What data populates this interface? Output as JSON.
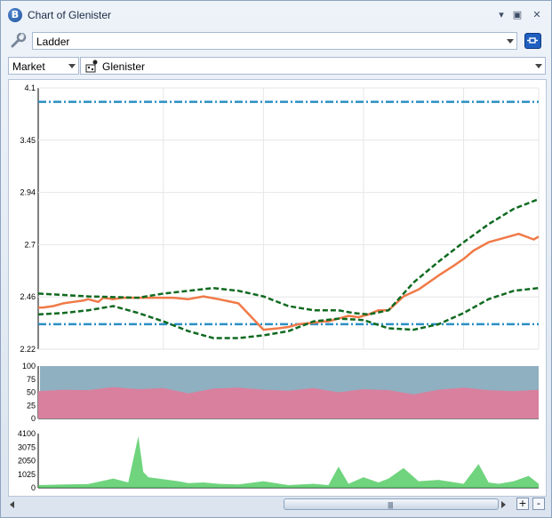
{
  "window": {
    "title": "Chart of Glenister",
    "app_icon_letter": "B",
    "pin_glyph": "▾",
    "maximize_glyph": "▣",
    "close_glyph": "✕"
  },
  "toolbar": {
    "view_select": "Ladder",
    "source_select": "Market",
    "runner_select": "Glenister"
  },
  "scrollbar": {
    "grip": "|||||",
    "zoom_in_label": "+",
    "zoom_out_label": "-"
  },
  "colors": {
    "price_line": "#f07a48",
    "band_line": "#0f6a20",
    "limit_line": "#2b8fc4",
    "back_fill": "#d9809f",
    "lay_fill": "#8fb0c0",
    "volume_fill": "#3fc552"
  },
  "chart_data": [
    {
      "type": "line",
      "name": "price",
      "yticks": [
        "4.1",
        "3.45",
        "2.94",
        "2.7",
        "2.46",
        "2.22"
      ],
      "ylim": [
        2.22,
        4.1
      ],
      "grid": true,
      "limit_lines": [
        4.0,
        2.4
      ],
      "series": [
        {
          "key": "price",
          "style": "solid",
          "x": [
            0,
            1,
            3,
            5,
            7,
            9,
            10,
            11,
            12,
            13,
            15,
            17,
            20,
            24,
            27,
            30,
            33,
            36,
            40,
            45,
            48,
            50,
            52,
            55,
            57,
            58,
            60,
            62,
            64,
            66,
            68,
            70,
            73,
            76,
            80,
            83,
            85,
            87,
            90,
            93,
            96,
            99,
            100
          ],
          "values": [
            2.52,
            2.52,
            2.53,
            2.55,
            2.56,
            2.57,
            2.58,
            2.57,
            2.56,
            2.59,
            2.58,
            2.59,
            2.59,
            2.59,
            2.59,
            2.58,
            2.6,
            2.58,
            2.55,
            2.36,
            2.37,
            2.38,
            2.4,
            2.41,
            2.42,
            2.42,
            2.44,
            2.46,
            2.45,
            2.47,
            2.5,
            2.5,
            2.6,
            2.65,
            2.75,
            2.82,
            2.87,
            2.93,
            2.99,
            3.02,
            3.05,
            3.01,
            3.03
          ]
        },
        {
          "key": "upper_band",
          "style": "dashed",
          "x": [
            0,
            10,
            20,
            25,
            30,
            35,
            40,
            45,
            50,
            55,
            60,
            63,
            66,
            70,
            75,
            80,
            85,
            90,
            95,
            100
          ],
          "values": [
            2.62,
            2.6,
            2.59,
            2.62,
            2.64,
            2.66,
            2.64,
            2.6,
            2.53,
            2.5,
            2.5,
            2.48,
            2.47,
            2.5,
            2.7,
            2.85,
            2.99,
            3.12,
            3.23,
            3.3
          ]
        },
        {
          "key": "lower_band",
          "style": "dashed",
          "x": [
            0,
            5,
            10,
            15,
            20,
            25,
            30,
            35,
            40,
            45,
            50,
            55,
            60,
            65,
            70,
            75,
            80,
            85,
            90,
            95,
            100
          ],
          "values": [
            2.47,
            2.48,
            2.5,
            2.53,
            2.48,
            2.42,
            2.35,
            2.3,
            2.3,
            2.32,
            2.35,
            2.42,
            2.44,
            2.43,
            2.37,
            2.36,
            2.4,
            2.48,
            2.58,
            2.64,
            2.66
          ]
        }
      ]
    },
    {
      "type": "area",
      "name": "weight-of-money",
      "yticks": [
        "100",
        "75",
        "50",
        "25",
        "0"
      ],
      "ylim": [
        0,
        100
      ],
      "series": [
        {
          "key": "back_share",
          "x": [
            0,
            5,
            10,
            15,
            20,
            25,
            30,
            35,
            40,
            45,
            50,
            55,
            60,
            65,
            70,
            75,
            80,
            85,
            90,
            95,
            100
          ],
          "values": [
            52,
            55,
            54,
            60,
            56,
            58,
            48,
            57,
            59,
            55,
            53,
            58,
            50,
            56,
            54,
            46,
            55,
            59,
            54,
            52,
            55
          ]
        }
      ]
    },
    {
      "type": "area",
      "name": "traded-volume",
      "yticks": [
        "4100",
        "3075",
        "2050",
        "1025",
        "0"
      ],
      "ylim": [
        0,
        4100
      ],
      "series": [
        {
          "key": "volume",
          "x": [
            0,
            5,
            10,
            15,
            18,
            20,
            21,
            22,
            24,
            26,
            28,
            30,
            33,
            36,
            40,
            45,
            50,
            55,
            58,
            60,
            62,
            65,
            68,
            70,
            73,
            76,
            80,
            85,
            88,
            90,
            92,
            95,
            98,
            100
          ],
          "values": [
            200,
            250,
            280,
            700,
            400,
            3900,
            1200,
            800,
            700,
            600,
            500,
            350,
            400,
            300,
            250,
            500,
            200,
            300,
            200,
            1600,
            300,
            800,
            400,
            700,
            1500,
            500,
            600,
            300,
            1800,
            400,
            300,
            500,
            900,
            300
          ]
        }
      ]
    }
  ]
}
